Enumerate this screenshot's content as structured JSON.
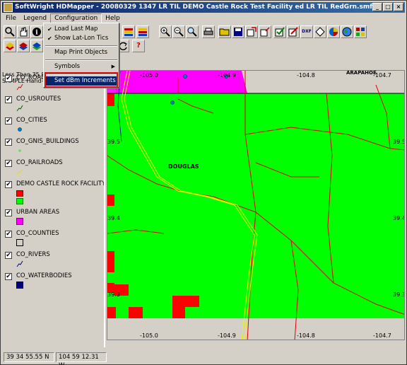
{
  "window": {
    "title": "SoftWright HDMapper - 20080329 1347 LR TIL DEMO Castle Rock Test Facility ed LR TIL RedGrn.smf",
    "minimize": "_",
    "maximize": "□",
    "close": "×"
  },
  "menu": {
    "file": "File",
    "legend": "Legend",
    "configuration": "Configuration",
    "help": "Help"
  },
  "config_menu": {
    "items": [
      {
        "label": "Load Last Map",
        "checked": "✔"
      },
      {
        "label": "Show Lat-Lon Tics",
        "checked": "✔"
      },
      {
        "label": "Map Print Objects"
      },
      {
        "label": "Symbols",
        "arrow": "▶"
      },
      {
        "label": "Set dBm Increments"
      }
    ]
  },
  "toolbar": {
    "help_glyph": "?",
    "dxf_label": "DXF",
    "info_glyph": "i"
  },
  "legend": {
    "layers": [
      {
        "name": "CO_ROADS",
        "checked": "✔"
      },
      {
        "name": "CO_USROUTES",
        "checked": "✔"
      },
      {
        "name": "CO_CITIES",
        "checked": "✔"
      },
      {
        "name": "CO_GNIS_BUILDINGS",
        "checked": "✔"
      },
      {
        "name": "CO_RAILROADS",
        "checked": "✔"
      },
      {
        "name": "DEMO CASTLE ROCK FACILITY (",
        "checked": "✔",
        "entries": [
          "Less Than 35.84",
          "SAMPLE Hand-held w/ sever"
        ]
      },
      {
        "name": "URBAN AREAS",
        "checked": "✔"
      },
      {
        "name": "CO_COUNTIES",
        "checked": "✔"
      },
      {
        "name": "CO_RIVERS",
        "checked": "✔"
      },
      {
        "name": "CO_WATERBODIES",
        "checked": "✔"
      }
    ]
  },
  "map": {
    "top_lon_labels": [
      "-105.0",
      "-104.9",
      "-104.8",
      "-104.7"
    ],
    "bottom_lon_labels": [
      "-105.0",
      "-104.9",
      "-104.8",
      "-104.7"
    ],
    "right_lat_labels": [
      "39.5",
      "39.4",
      "39.3"
    ],
    "left_lat_labels": [
      "39.5",
      "39.4",
      "39.3"
    ],
    "place_label": "DOUGLAS",
    "corner_label": "ARAPAHOE",
    "colors": {
      "coverage_green": "#00ff00",
      "weak_red": "#ff0000",
      "urban_magenta": "#ff00ff",
      "roads": "#e00000",
      "rail": "#ffff00"
    }
  },
  "status": {
    "lat": "39 34 55.55 N",
    "lon": "104 59 12.31 W"
  }
}
